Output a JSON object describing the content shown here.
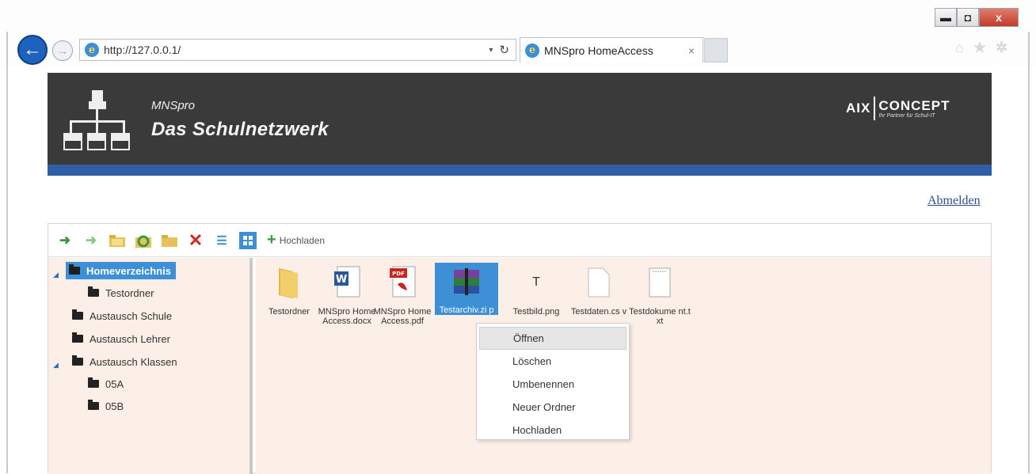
{
  "browser": {
    "url": "http://127.0.0.1/",
    "tab_title": "MNSpro HomeAccess",
    "tab_close": "×",
    "back_glyph": "←",
    "forward_glyph": "→",
    "refresh_glyph": "↻",
    "dropdown_glyph": "▾",
    "window_controls": {
      "minimize": "▬",
      "maximize": "◘",
      "close": "x"
    },
    "right_icons": [
      "home-icon",
      "favorites-star-icon",
      "settings-gear-icon"
    ],
    "right_glyphs": {
      "home": "⌂",
      "star": "★",
      "gear": "✲"
    }
  },
  "header": {
    "product": "MNSpro",
    "title": "Das Schulnetzwerk",
    "brand_left": "AIX",
    "brand_right": "CONCEPT",
    "brand_tagline": "Ihr Partner für Schul-IT",
    "background_color": "#3a3a3a",
    "stripe_color": "#2f5ea6"
  },
  "logout_label": "Abmelden",
  "toolbar": {
    "icons": [
      "back-arrow-icon",
      "forward-arrow-icon",
      "open-folder-icon",
      "refresh-icon",
      "new-folder-icon",
      "delete-icon",
      "list-view-icon",
      "tile-view-icon"
    ],
    "upload_label": "Hochladen"
  },
  "tree": {
    "items": [
      {
        "label": "Homeverzeichnis",
        "selected": true,
        "expanded": true
      },
      {
        "label": "Testordner"
      },
      {
        "label": "Austausch Schule"
      },
      {
        "label": "Austausch Lehrer"
      },
      {
        "label": "Austausch Klassen",
        "expanded": true
      },
      {
        "label": "05A"
      },
      {
        "label": "05B"
      }
    ],
    "expand_glyph": "◢"
  },
  "files": [
    {
      "name": "Testordner",
      "icon": "folder-icon"
    },
    {
      "name": "MNSpro Home Access.docx",
      "icon": "word-document-icon",
      "badge": "W"
    },
    {
      "name": "MNSpro Home Access.pdf",
      "icon": "pdf-document-icon",
      "badge": "PDF"
    },
    {
      "name": "Testarchiv.zi p",
      "icon": "archive-icon",
      "selected": true
    },
    {
      "name": "Testbild.png",
      "icon": "image-file-icon",
      "badge": "T"
    },
    {
      "name": "Testdaten.cs v",
      "icon": "csv-file-icon"
    },
    {
      "name": "Testdokume nt.txt",
      "icon": "text-file-icon"
    }
  ],
  "context_menu": {
    "items": [
      "Öffnen",
      "Löschen",
      "Umbenennen",
      "Neuer Ordner",
      "Hochladen"
    ],
    "hovered_index": 0
  },
  "colors": {
    "selection": "#3d8fd6",
    "content_bg": "#fbefe7",
    "link": "#2d4f8f",
    "upload_plus": "#3c9a3a",
    "delete_red": "#d02b20"
  }
}
